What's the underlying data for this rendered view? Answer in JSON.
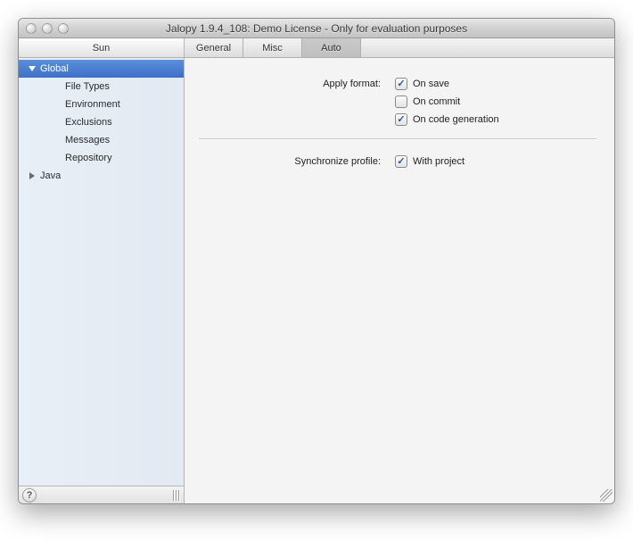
{
  "window": {
    "title": "Jalopy 1.9.4_108:  Demo License - Only for evaluation purposes"
  },
  "sidebar": {
    "header": "Sun",
    "items": [
      {
        "label": "Global",
        "expanded": true,
        "selected": true
      },
      {
        "label": "Java",
        "expanded": false,
        "selected": false
      }
    ],
    "global_children": [
      {
        "label": "File Types"
      },
      {
        "label": "Environment"
      },
      {
        "label": "Exclusions"
      },
      {
        "label": "Messages"
      },
      {
        "label": "Repository"
      }
    ]
  },
  "tabs": [
    {
      "label": "General",
      "active": false
    },
    {
      "label": "Misc",
      "active": false
    },
    {
      "label": "Auto",
      "active": true
    }
  ],
  "form": {
    "apply_label": "Apply format:",
    "sync_label": "Synchronize profile:",
    "checks": {
      "on_save": {
        "label": "On save",
        "checked": true
      },
      "on_commit": {
        "label": "On commit",
        "checked": false
      },
      "on_codegen": {
        "label": "On code generation",
        "checked": true
      },
      "with_project": {
        "label": "With project",
        "checked": true
      }
    }
  },
  "help_glyph": "?"
}
